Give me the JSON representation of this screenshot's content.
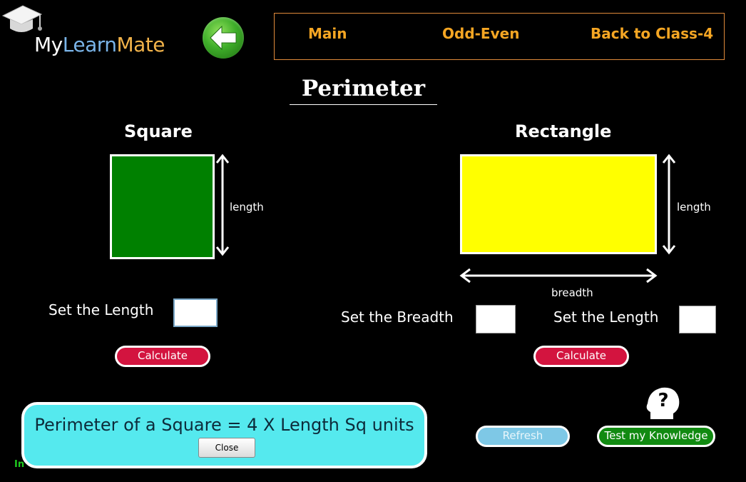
{
  "logo": {
    "my": "My",
    "learn": "Learn",
    "mate": "Mate",
    "icon": "graduation-cap-icon"
  },
  "back_button": {
    "icon": "arrow-left-icon"
  },
  "nav": {
    "items": [
      {
        "label": "Main"
      },
      {
        "label": "Odd-Even"
      },
      {
        "label": "Back to Class-4"
      }
    ]
  },
  "page_title": "Perimeter",
  "square": {
    "title": "Square",
    "shape_color": "#008000",
    "dimension_label": "length",
    "set_length_label": "Set the Length",
    "length_value": "",
    "calculate_label": "Calculate"
  },
  "rectangle": {
    "title": "Rectangle",
    "shape_color": "#ffff00",
    "length_label": "length",
    "breadth_label": "breadth",
    "set_breadth_label": "Set the Breadth",
    "breadth_value": "",
    "set_length_label": "Set the Length",
    "length_value": "",
    "calculate_label": "Calculate"
  },
  "formula_popup": {
    "text": "Perimeter of a Square = 4 X Length Sq units",
    "close_label": "Close"
  },
  "refresh_label": "Refresh",
  "test_knowledge_label": "Test my Knowledge",
  "help_icon": "question-head-icon",
  "bottom_text": "In"
}
